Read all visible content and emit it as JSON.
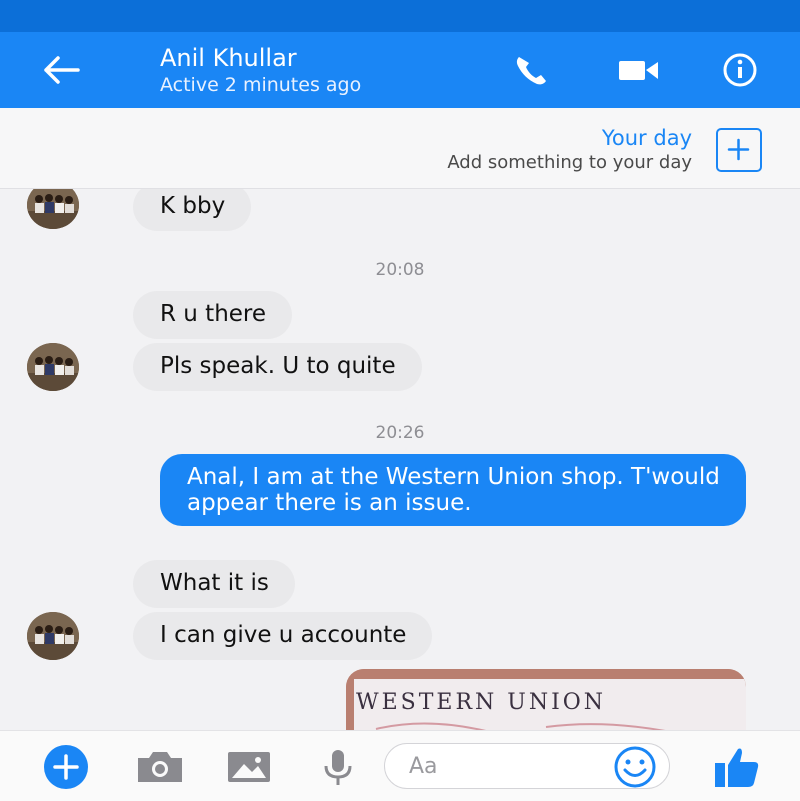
{
  "header": {
    "contact_name": "Anil Khullar",
    "status": "Active 2 minutes ago"
  },
  "your_day": {
    "title": "Your day",
    "subtitle": "Add something to your day"
  },
  "messages": [
    {
      "direction": "incoming",
      "text": "K bby"
    },
    {
      "type": "timestamp",
      "text": "20:08"
    },
    {
      "direction": "incoming",
      "text": "R u there"
    },
    {
      "direction": "incoming",
      "text": "Pls speak. U to quite"
    },
    {
      "type": "timestamp",
      "text": "20:26"
    },
    {
      "direction": "outgoing",
      "text": "Anal, I am at the Western Union shop. T'would appear there is an issue."
    },
    {
      "direction": "incoming",
      "text": "What it is"
    },
    {
      "direction": "incoming",
      "text": "I can give u accounte"
    },
    {
      "direction": "outgoing",
      "type": "photo",
      "photo_text": "WESTERN UNION"
    }
  ],
  "composer": {
    "placeholder": "Aa"
  },
  "colors": {
    "header_blue": "#1a86f5",
    "status_bar": "#0c6fd8",
    "incoming_bubble": "#e9e9eb",
    "outgoing_bubble": "#1a86f5"
  },
  "icons": [
    "back-arrow-icon",
    "phone-icon",
    "video-camera-icon",
    "info-icon",
    "plus-icon",
    "camera-icon",
    "image-icon",
    "microphone-icon",
    "emoji-icon",
    "thumbs-up-icon"
  ]
}
